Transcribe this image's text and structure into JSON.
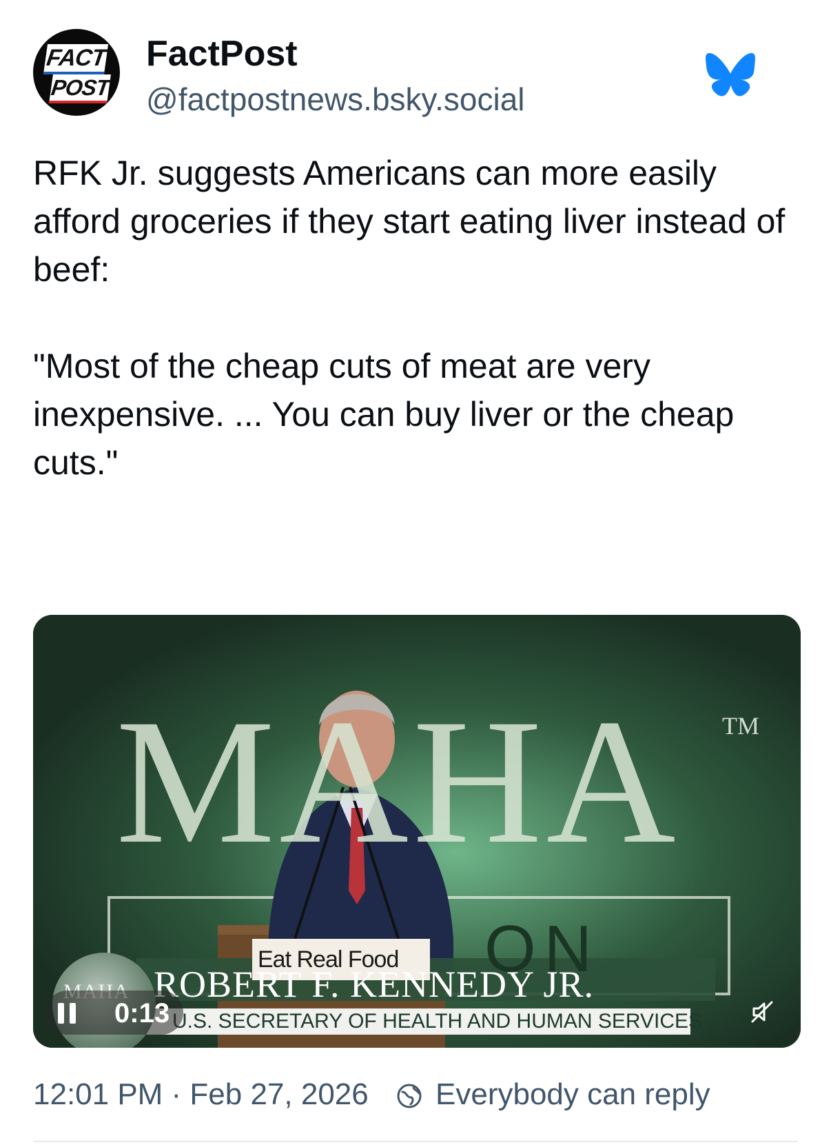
{
  "author": {
    "display_name": "FactPost",
    "handle": "@factpostnews.bsky.social",
    "avatar_text_top": "FACT",
    "avatar_text_bottom": "POST"
  },
  "post": {
    "text": "RFK Jr. suggests Americans can more easily afford groceries if they start eating liver instead of beef:\n\n\"Most of the cheap cuts of meat are very inexpensive. ... You can buy liver or the cheap cuts.\""
  },
  "video": {
    "timecode": "0:13",
    "state_icon": "pause-icon",
    "mute_icon": "mute-off-icon",
    "scene": {
      "backdrop_text": "MAHA",
      "trademark": "TM",
      "backdrop_fragment": "ON",
      "podium_sign": "Eat Real Food",
      "chyron_name": "ROBERT F. KENNEDY JR.",
      "chyron_title": "U.S. SECRETARY OF HEALTH AND HUMAN SERVICES",
      "bug_text": "MAHA"
    }
  },
  "meta": {
    "timestamp": "12:01 PM · Feb 27, 2026",
    "reply_setting": "Everybody can reply",
    "reply_icon": "globe-icon"
  },
  "colors": {
    "bluesky_blue": "#1185fe",
    "muted_text": "#42566b",
    "video_bg": "#1d3324"
  }
}
